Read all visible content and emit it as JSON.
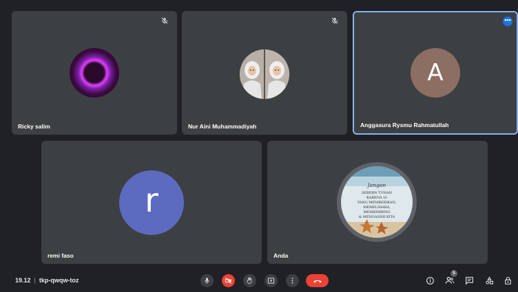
{
  "participants": [
    {
      "name": "Ricky salim",
      "muted": true,
      "avatar": "profile-photo"
    },
    {
      "name": "Nur Aini Muhammadiyah",
      "muted": true,
      "avatar": "profile-photo"
    },
    {
      "name": "Anggasura Rysmu Rahmatullah",
      "muted": false,
      "avatar_letter": "A",
      "avatar_color": "#8d6e63",
      "speaking": true
    },
    {
      "name": "remi faso",
      "avatar_letter": "r",
      "avatar_color": "#5c6bc0"
    },
    {
      "name": "Anda",
      "avatar": "profile-photo",
      "photo_text": {
        "title": "Jangan",
        "lines": [
          "SEBERN TUHAN",
          "KARENA IA",
          "YANG MEMBERIKAN,",
          "MEMELIHARA,",
          "MEMBIMBING",
          "& MENGASIHI KITA"
        ]
      }
    }
  ],
  "bottom_bar": {
    "time": "19.12",
    "separator": "|",
    "meeting_code": "tkp-qwqw-toz",
    "participants_count": "5"
  },
  "icons": {
    "more": "more-options-icon",
    "mic": "microphone-icon",
    "camera_off": "camera-off-icon",
    "hand": "raise-hand-icon",
    "present": "present-screen-icon",
    "more_vert": "more-vert-icon",
    "end": "end-call-icon",
    "info": "info-icon",
    "people": "people-icon",
    "chat": "chat-icon",
    "activities": "activities-icon",
    "lock": "host-controls-icon"
  },
  "colors": {
    "background": "#202124",
    "tile": "#3c4043",
    "active_border": "#8ab4f8",
    "end_call": "#ea4335"
  }
}
